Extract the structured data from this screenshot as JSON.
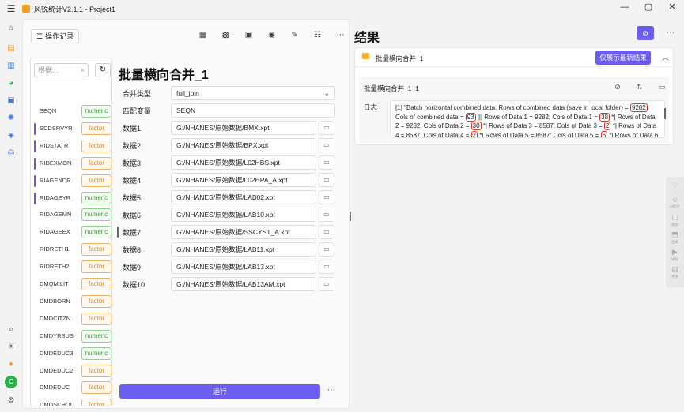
{
  "window": {
    "title": "风锐统计V2.1.1 - Project1",
    "controls": [
      "—",
      "▢",
      "✕"
    ]
  },
  "main": {
    "history_label": "操作记录",
    "var_search_placeholder": "根据...",
    "variables": [
      {
        "name": "SEQN",
        "type": "numeric",
        "bar": false
      },
      {
        "name": "SDDSRVYR",
        "type": "factor",
        "bar": true
      },
      {
        "name": "RIDSTATR",
        "type": "factor",
        "bar": true
      },
      {
        "name": "RIDEXMON",
        "type": "factor",
        "bar": true
      },
      {
        "name": "RIAGENDR",
        "type": "factor",
        "bar": true
      },
      {
        "name": "RIDAGEYR",
        "type": "numeric",
        "bar": true
      },
      {
        "name": "RIDAGEMN",
        "type": "numeric",
        "bar": false
      },
      {
        "name": "RIDAGEEX",
        "type": "numeric",
        "bar": false
      },
      {
        "name": "RIDRETH1",
        "type": "factor",
        "bar": false
      },
      {
        "name": "RIDRETH2",
        "type": "factor",
        "bar": false
      },
      {
        "name": "DMQMILIT",
        "type": "factor",
        "bar": false
      },
      {
        "name": "DMDBORN",
        "type": "factor",
        "bar": false
      },
      {
        "name": "DMDCITZN",
        "type": "factor",
        "bar": false
      },
      {
        "name": "DMDYRSUS",
        "type": "numeric",
        "bar": false
      },
      {
        "name": "DMDEDUC3",
        "type": "numeric",
        "bar": false
      },
      {
        "name": "DMDEDUC2",
        "type": "factor",
        "bar": false
      },
      {
        "name": "DMDEDUC",
        "type": "factor",
        "bar": false
      },
      {
        "name": "DMDSCHOL",
        "type": "factor",
        "bar": false
      }
    ],
    "form": {
      "title": "批量横向合并_1",
      "merge_type_label": "合并类型",
      "merge_type_value": "full_join",
      "match_var_label": "匹配变量",
      "match_var_value": "SEQN",
      "datasets": [
        {
          "label": "数据1",
          "path": "G:/NHANES/原始数据/BMX.xpt"
        },
        {
          "label": "数据2",
          "path": "G:/NHANES/原始数据/BPX.xpt"
        },
        {
          "label": "数据3",
          "path": "G:/NHANES/原始数据/L02HBS.xpt"
        },
        {
          "label": "数据4",
          "path": "G:/NHANES/原始数据/L02HPA_A.xpt"
        },
        {
          "label": "数据5",
          "path": "G:/NHANES/原始数据/LAB02.xpt"
        },
        {
          "label": "数据6",
          "path": "G:/NHANES/原始数据/LAB10.xpt"
        },
        {
          "label": "数据7",
          "path": "G:/NHANES/原始数据/SSCYST_A.xpt"
        },
        {
          "label": "数据8",
          "path": "G:/NHANES/原始数据/LAB11.xpt"
        },
        {
          "label": "数据9",
          "path": "G:/NHANES/原始数据/LAB13.xpt"
        },
        {
          "label": "数据10",
          "path": "G:/NHANES/原始数据/LAB13AM.xpt"
        }
      ],
      "run_label": "运行"
    }
  },
  "result": {
    "title": "结果",
    "card_title": "批量横向合并_1",
    "latest_label": "仅展示最新结果",
    "inner_title": "批量横向合并_1_1",
    "log_label": "日志",
    "log": {
      "p1": "[1] \"Batch horizontal combined data:  Rows of combined data (save in local folder) = ",
      "v1": "9282",
      "p2": " Cols of combined data = ",
      "v2": "93",
      "p3": " |||  Rows of Data 1 = 9282; Cols of Data 1 = ",
      "v3": "38",
      "p4": " *| Rows of Data 2 = 9282; Cols of Data 2 = ",
      "v4": "30",
      "p5": " *| Rows of Data 3 = 8587; Cols of Data 3 = ",
      "v5": "2",
      "p6": " *| Rows of Data 4 = 8587; Cols of Data 4 = ",
      "v6": "2",
      "p7": " *| Rows of Data 5 = 8587; Cols of Data 5 = ",
      "v7": "6",
      "p8": " *| Rows of Data 6 = 6758; Cols of Data"
    }
  },
  "float_bar": [
    "AI助手",
    "截图",
    "全屏",
    "录屏",
    "更多"
  ],
  "colors": {
    "accent": "#6b5df0",
    "numeric": "#3c9a3c",
    "factor": "#d8882a",
    "highlight": "#e03020"
  }
}
